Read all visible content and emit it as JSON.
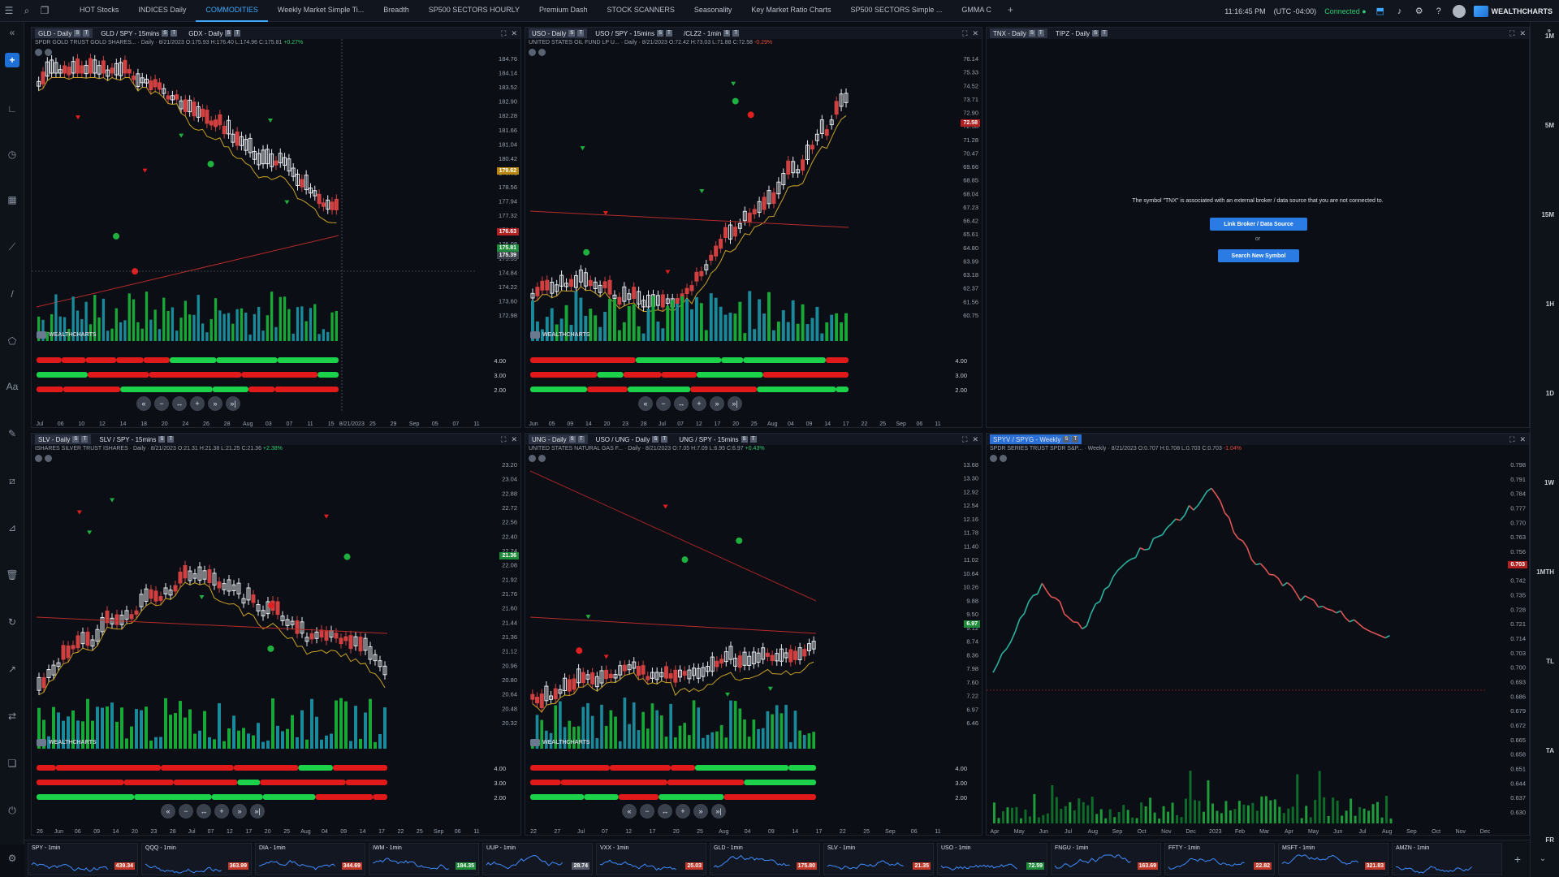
{
  "topbar": {
    "tabs": [
      {
        "label": "HOT Stocks",
        "active": false
      },
      {
        "label": "INDICES Daily",
        "active": false
      },
      {
        "label": "COMMODITIES",
        "active": true
      },
      {
        "label": "Weekly Market Simple Ti...",
        "active": false
      },
      {
        "label": "Breadth",
        "active": false
      },
      {
        "label": "SP500 SECTORS HOURLY",
        "active": false
      },
      {
        "label": "Premium Dash",
        "active": false
      },
      {
        "label": "STOCK SCANNERS",
        "active": false
      },
      {
        "label": "Seasonality",
        "active": false
      },
      {
        "label": "Key Market Ratio Charts",
        "active": false
      },
      {
        "label": "SP500 SECTORS Simple ...",
        "active": false
      },
      {
        "label": "GMMA C",
        "active": false
      }
    ],
    "add": "+",
    "time": "11:16:45 PM",
    "timezone": "(UTC -04:00)",
    "connection": "Connected",
    "brand": "WEALTHCHARTS"
  },
  "timeframes": [
    "1M",
    "5M",
    "15M",
    "1H",
    "1D",
    "1W",
    "1MTH",
    "TL",
    "TA",
    "FR"
  ],
  "panels": [
    {
      "id": "gld",
      "tabs": [
        "GLD - Daily",
        "GLD / SPY - 15mins",
        "GDX - Daily"
      ],
      "subtitle": "SPDR GOLD TRUST GOLD SHARES... · Daily · 8/21/2023 O:175.93 H:176.40 L:174.96 C:175.81",
      "change": "+0.27%",
      "changeDir": "up",
      "yTicks": [
        "184.76",
        "184.14",
        "183.52",
        "182.90",
        "182.28",
        "181.66",
        "181.04",
        "180.42",
        "179.62",
        "178.56",
        "177.94",
        "177.32",
        "176.63",
        "176.08",
        "175.39",
        "174.84",
        "174.22",
        "173.60",
        "172.98"
      ],
      "xTicks": [
        "Jul",
        "06",
        "10",
        "12",
        "14",
        "18",
        "20",
        "24",
        "26",
        "28",
        "Aug",
        "03",
        "07",
        "11",
        "15",
        "8/21/2023",
        "25",
        "29",
        "Sep",
        "05",
        "07",
        "11"
      ],
      "priceTags": [
        {
          "label": "179.62",
          "color": "#b8860b"
        },
        {
          "label": "176.63",
          "color": "#b22222"
        },
        {
          "label": "175.81",
          "color": "#1e8b3a"
        },
        {
          "label": "175.39",
          "color": "#3a404c"
        }
      ],
      "indLevels": [
        "4.00",
        "3.00",
        "2.00"
      ]
    },
    {
      "id": "uso",
      "tabs": [
        "USO - Daily",
        "USO / SPY - 15mins",
        "/CLZ2 - 1min"
      ],
      "subtitle": "UNITED STATES OIL FUND LP U... · Daily · 8/21/2023 O:72.42 H:73.03 L:71.88 C:72.58",
      "change": "-0.29%",
      "changeDir": "dn",
      "yTicks": [
        "76.14",
        "75.33",
        "74.52",
        "73.71",
        "72.90",
        "72.58",
        "71.28",
        "70.47",
        "69.66",
        "68.85",
        "68.04",
        "67.23",
        "66.42",
        "65.61",
        "64.80",
        "63.99",
        "63.18",
        "62.37",
        "61.56",
        "60.75"
      ],
      "xTicks": [
        "Jun",
        "05",
        "09",
        "14",
        "20",
        "23",
        "28",
        "Jul",
        "07",
        "12",
        "17",
        "20",
        "25",
        "Aug",
        "04",
        "09",
        "14",
        "17",
        "22",
        "25",
        "Sep",
        "06",
        "11"
      ],
      "priceTags": [
        {
          "label": "72.58",
          "color": "#b22222"
        }
      ],
      "indLevels": [
        "4.00",
        "3.00",
        "2.00"
      ]
    },
    {
      "id": "tnx",
      "tabs": [
        "TNX - Daily",
        "TIPZ - Daily"
      ],
      "message": "The symbol \"TNX\" is associated with an external broker / data source that you are not connected to.",
      "linkButton": "Link Broker / Data Source",
      "or": "or",
      "searchButton": "Search New Symbol"
    },
    {
      "id": "slv",
      "tabs": [
        "SLV - Daily",
        "SLV / SPY - 15mins"
      ],
      "subtitle": "ISHARES SILVER TRUST ISHARES · Daily · 8/21/2023 O:21.31 H:21.38 L:21.25 C:21.36",
      "change": "+2.38%",
      "changeDir": "up",
      "yTicks": [
        "23.20",
        "23.04",
        "22.88",
        "22.72",
        "22.56",
        "22.40",
        "22.24",
        "22.08",
        "21.92",
        "21.76",
        "21.60",
        "21.44",
        "21.36",
        "21.12",
        "20.96",
        "20.80",
        "20.64",
        "20.48",
        "20.32"
      ],
      "xTicks": [
        "26",
        "Jun",
        "06",
        "09",
        "14",
        "20",
        "23",
        "28",
        "Jul",
        "07",
        "12",
        "17",
        "20",
        "25",
        "Aug",
        "04",
        "09",
        "14",
        "17",
        "22",
        "25",
        "Sep",
        "06",
        "11"
      ],
      "priceTags": [
        {
          "label": "21.36",
          "color": "#1e8b3a"
        }
      ],
      "indLevels": [
        "4.00",
        "3.00",
        "2.00"
      ]
    },
    {
      "id": "ung",
      "tabs": [
        "UNG - Daily",
        "USO / UNG - Daily",
        "UNG / SPY - 15mins"
      ],
      "subtitle": "UNITED STATES NATURAL GAS F... · Daily · 8/21/2023 O:7.05 H:7.09 L:6.95 C:6.97",
      "change": "+0.43%",
      "changeDir": "up",
      "yTicks": [
        "13.68",
        "13.30",
        "12.92",
        "12.54",
        "12.16",
        "11.78",
        "11.40",
        "11.02",
        "10.64",
        "10.26",
        "9.88",
        "9.50",
        "9.12",
        "8.74",
        "8.36",
        "7.98",
        "7.60",
        "7.22",
        "6.97",
        "6.46"
      ],
      "xTicks": [
        "22",
        "27",
        "Jul",
        "07",
        "12",
        "17",
        "20",
        "25",
        "Aug",
        "04",
        "09",
        "14",
        "17",
        "22",
        "25",
        "Sep",
        "06",
        "11"
      ],
      "priceTags": [
        {
          "label": "6.97",
          "color": "#1e8b3a"
        }
      ],
      "indLevels": [
        "4.00",
        "3.00",
        "2.00"
      ]
    },
    {
      "id": "spyv",
      "tabs": [
        "SPYV / SPYG - Weekly"
      ],
      "subtitle": "SPDR SERIES TRUST SPDR S&P... · Weekly · 8/21/2023 O:0.707 H:0.708 L:0.703 C:0.703",
      "change": "-1.04%",
      "changeDir": "dn",
      "yTicks": [
        "0.798",
        "0.791",
        "0.784",
        "0.777",
        "0.770",
        "0.763",
        "0.756",
        "0.749",
        "0.742",
        "0.735",
        "0.728",
        "0.721",
        "0.714",
        "0.703",
        "0.700",
        "0.693",
        "0.686",
        "0.679",
        "0.672",
        "0.665",
        "0.658",
        "0.651",
        "0.644",
        "0.637",
        "0.630"
      ],
      "xTicks": [
        "Apr",
        "May",
        "Jun",
        "Jul",
        "Aug",
        "Sep",
        "Oct",
        "Nov",
        "Dec",
        "2023",
        "Feb",
        "Mar",
        "Apr",
        "May",
        "Jun",
        "Jul",
        "Aug",
        "Sep",
        "Oct",
        "Nov",
        "Dec"
      ],
      "priceTags": [
        {
          "label": "0.703",
          "color": "#b22222"
        }
      ]
    }
  ],
  "watermark": "WEALTHCHARTS",
  "tickers": [
    {
      "name": "SPY - 1min",
      "price": "439.34",
      "color": "#c0392b"
    },
    {
      "name": "QQQ - 1min",
      "price": "363.99",
      "color": "#c0392b"
    },
    {
      "name": "DIA - 1min",
      "price": "344.69",
      "color": "#c0392b"
    },
    {
      "name": "IWM - 1min",
      "price": "184.35",
      "color": "#1e8b3a"
    },
    {
      "name": "UUP - 1min",
      "price": "28.74",
      "color": "#555b66"
    },
    {
      "name": "VXX - 1min",
      "price": "25.03",
      "color": "#c0392b"
    },
    {
      "name": "GLD - 1min",
      "price": "175.80",
      "color": "#c0392b"
    },
    {
      "name": "SLV - 1min",
      "price": "21.35",
      "color": "#c0392b"
    },
    {
      "name": "USO - 1min",
      "price": "72.59",
      "color": "#1e8b3a"
    },
    {
      "name": "FNGU - 1min",
      "price": "163.69",
      "color": "#c0392b"
    },
    {
      "name": "FFTY - 1min",
      "price": "22.82",
      "color": "#c0392b"
    },
    {
      "name": "MSFT - 1min",
      "price": "321.83",
      "color": "#c0392b"
    },
    {
      "name": "AMZN - 1min",
      "price": "",
      "color": "#c0392b"
    }
  ],
  "zoomControls": [
    "«",
    "−",
    "↔",
    "+",
    "»",
    "»|"
  ]
}
